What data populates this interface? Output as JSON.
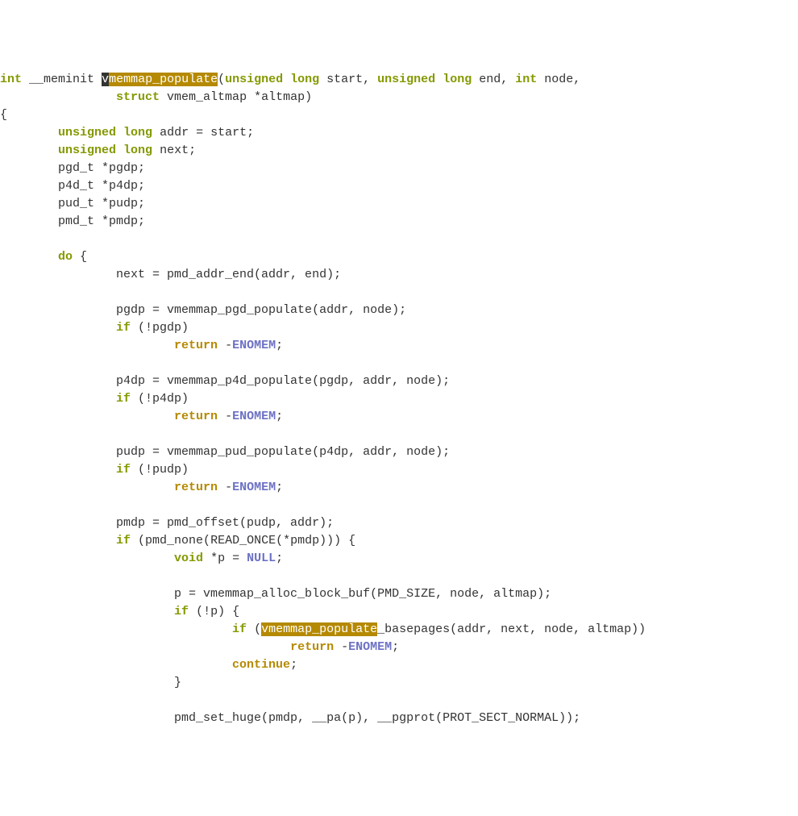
{
  "code": {
    "line1_a": "int",
    "line1_b": " __meminit ",
    "line1_hl_cursor": "v",
    "line1_hl": "memmap_populate",
    "line1_c": "(",
    "line1_d": "unsigned",
    "line1_e": " ",
    "line1_f": "long",
    "line1_g": " start, ",
    "line1_h": "unsigned",
    "line1_i": " ",
    "line1_j": "long",
    "line1_k": " end, ",
    "line1_l": "int",
    "line1_m": " node,",
    "line2_a": "                ",
    "line2_b": "struct",
    "line2_c": " vmem_altmap *altmap)",
    "line3": "{",
    "line4_a": "        ",
    "line4_b": "unsigned",
    "line4_c": " ",
    "line4_d": "long",
    "line4_e": " addr = start;",
    "line5_a": "        ",
    "line5_b": "unsigned",
    "line5_c": " ",
    "line5_d": "long",
    "line5_e": " next;",
    "line6": "        pgd_t *pgdp;",
    "line7": "        p4d_t *p4dp;",
    "line8": "        pud_t *pudp;",
    "line9": "        pmd_t *pmdp;",
    "line10": "",
    "line11_a": "        ",
    "line11_b": "do",
    "line11_c": " {",
    "line12": "                next = pmd_addr_end(addr, end);",
    "line13": "",
    "line14": "                pgdp = vmemmap_pgd_populate(addr, node);",
    "line15_a": "                ",
    "line15_b": "if",
    "line15_c": " (!pgdp)",
    "line16_a": "                        ",
    "line16_b": "return",
    "line16_c": " -",
    "line16_d": "ENOMEM",
    "line16_e": ";",
    "line17": "",
    "line18": "                p4dp = vmemmap_p4d_populate(pgdp, addr, node);",
    "line19_a": "                ",
    "line19_b": "if",
    "line19_c": " (!p4dp)",
    "line20_a": "                        ",
    "line20_b": "return",
    "line20_c": " -",
    "line20_d": "ENOMEM",
    "line20_e": ";",
    "line21": "",
    "line22": "                pudp = vmemmap_pud_populate(p4dp, addr, node);",
    "line23_a": "                ",
    "line23_b": "if",
    "line23_c": " (!pudp)",
    "line24_a": "                        ",
    "line24_b": "return",
    "line24_c": " -",
    "line24_d": "ENOMEM",
    "line24_e": ";",
    "line25": "",
    "line26": "                pmdp = pmd_offset(pudp, addr);",
    "line27_a": "                ",
    "line27_b": "if",
    "line27_c": " (pmd_none(READ_ONCE(*pmdp))) {",
    "line28_a": "                        ",
    "line28_b": "void",
    "line28_c": " *p = ",
    "line28_d": "NULL",
    "line28_e": ";",
    "line29": "",
    "line30": "                        p = vmemmap_alloc_block_buf(PMD_SIZE, node, altmap);",
    "line31_a": "                        ",
    "line31_b": "if",
    "line31_c": " (!p) {",
    "line32_a": "                                ",
    "line32_b": "if",
    "line32_c": " (",
    "line32_hl": "vmemmap_populate",
    "line32_d": "_basepages(addr, next, node, altmap))",
    "line33_a": "                                        ",
    "line33_b": "return",
    "line33_c": " -",
    "line33_d": "ENOMEM",
    "line33_e": ";",
    "line34_a": "                                ",
    "line34_b": "continue",
    "line34_c": ";",
    "line35": "                        }",
    "line36": "",
    "line37": "                        pmd_set_huge(pmdp, __pa(p), __pgprot(PROT_SECT_NORMAL));"
  }
}
